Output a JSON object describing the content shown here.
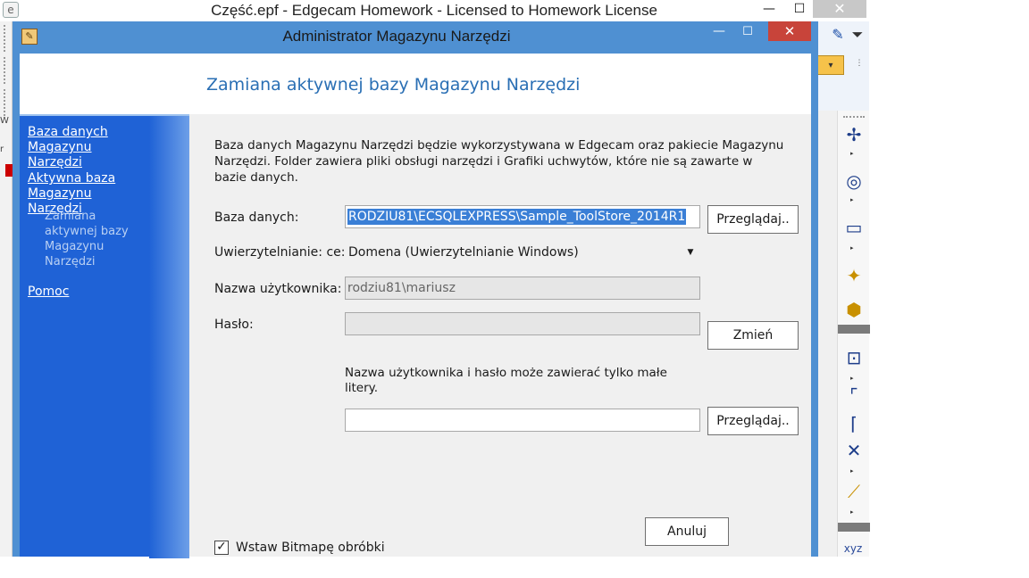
{
  "outer_window": {
    "title": "Część.epf - Edgecam Homework - Licensed to Homework License",
    "min": "—",
    "max": "☐",
    "close": "✕",
    "left_marks": [
      "W",
      "r"
    ],
    "right_label": "xyz"
  },
  "dialog": {
    "title": "Administrator Magazynu Narzędzi",
    "min": "—",
    "max": "☐",
    "close": "✕",
    "heading": "Zamiana aktywnej bazy Magazynu Narzędzi"
  },
  "sidebar": {
    "link1": "Baza danych Magazynu Narzędzi",
    "link2": "Aktywna baza Magazynu Narzędzi",
    "current": "Zamiana aktywnej bazy Magazynu Narzędzi",
    "link3": "Pomoc"
  },
  "content": {
    "description": "Baza danych Magazynu Narzędzi będzie wykorzystywana w Edgecam oraz pakiecie Magazynu Narzędzi. Folder zawiera pliki obsługi narzędzi i Grafiki uchwytów, które nie są zawarte w bazie danych.",
    "db_label": "Baza danych:",
    "db_value": "RODZIU81\\ECSQLEXPRESS\\Sample_ToolStore_2014R1",
    "browse_label": "Przeglądaj..",
    "auth_label": "Uwierzytelnianie: ce:",
    "auth_value": "Domena (Uwierzytelnianie Windows)",
    "user_label": "Nazwa użytkownika:",
    "user_value": "rodziu81\\mariusz",
    "password_label": "Hasło:",
    "password_value": "",
    "change_label": "Zmień",
    "note": "Nazwa użytkownika i hasło może zawierać tylko małe litery.",
    "folder_value": "",
    "browse2_label": "Przeglądaj..",
    "checkbox_label": "Wstaw Bitmapę obróbki",
    "checkbox_checked": true,
    "cancel_label": "Anuluj"
  },
  "colors": {
    "dialog_frame": "#4f90d2",
    "sidebar": "#1f62d6",
    "heading": "#2a6fb4",
    "selection": "#3a7fd6",
    "close": "#c8443a"
  }
}
